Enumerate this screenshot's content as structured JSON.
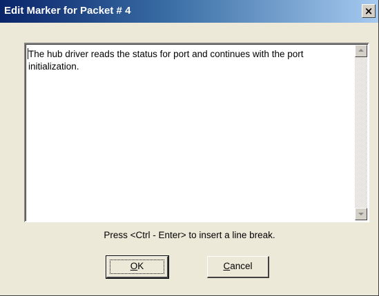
{
  "window": {
    "title": "Edit Marker for Packet # 4",
    "close_label": "×"
  },
  "editor": {
    "text": "The hub driver reads the status for port and continues with the port initialization."
  },
  "hint": "Press <Ctrl - Enter> to insert a line break.",
  "buttons": {
    "ok_mnemonic": "O",
    "ok_rest": "K",
    "cancel_mnemonic": "C",
    "cancel_rest": "ancel"
  },
  "icons": {
    "close": "close-icon",
    "scroll_up": "scroll-up-arrow-icon",
    "scroll_down": "scroll-down-arrow-icon"
  }
}
